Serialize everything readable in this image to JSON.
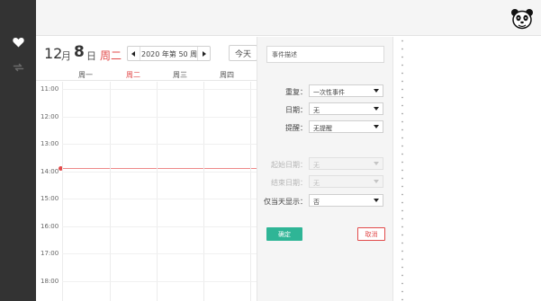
{
  "colors": {
    "sidebar_bg": "#333333",
    "accent_red": "#e24a4a",
    "confirm_green": "#2fb596",
    "panel_bg": "#f5f5f5"
  },
  "sidebar": {
    "items": [
      {
        "icon": "heart-icon"
      },
      {
        "icon": "sync-icon"
      }
    ]
  },
  "header": {
    "avatar_icon": "panda-avatar"
  },
  "calendar": {
    "month": "12",
    "month_unit": "月",
    "day": "8",
    "day_unit": "日",
    "weekday": "周二",
    "week_label": "2020 年第 50 周",
    "today_label": "今天",
    "day_headers": [
      "周一",
      "周二",
      "周三",
      "周四"
    ],
    "current_day_index": 1,
    "times": [
      "11:00",
      "12:00",
      "13:00",
      "14:00",
      "15:00",
      "16:00",
      "17:00",
      "18:00"
    ],
    "current_time": "14:00"
  },
  "event_form": {
    "description_placeholder": "事件描述",
    "fields": [
      {
        "label": "重复：",
        "value": "一次性事件",
        "disabled": false
      },
      {
        "label": "日期：",
        "value": "无",
        "disabled": false
      },
      {
        "label": "提醒：",
        "value": "无提醒",
        "disabled": false
      },
      {
        "label": "起始日期：",
        "value": "无",
        "disabled": true
      },
      {
        "label": "结束日期：",
        "value": "无",
        "disabled": true
      },
      {
        "label": "仅当天显示：",
        "value": "否",
        "disabled": false
      }
    ],
    "confirm_label": "确定",
    "cancel_label": "取消"
  }
}
